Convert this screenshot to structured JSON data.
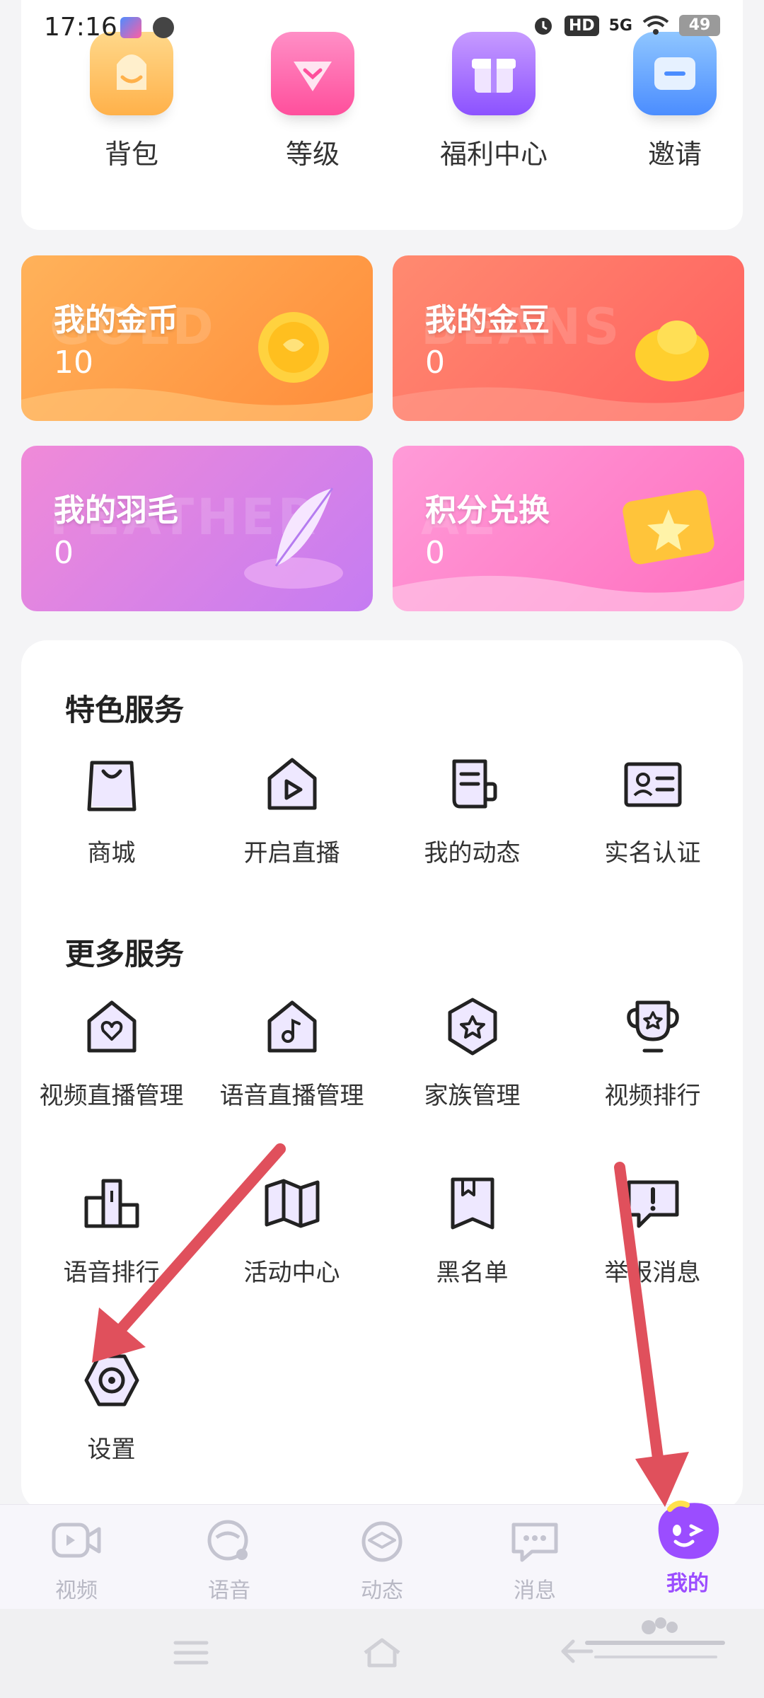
{
  "status": {
    "time": "17:16",
    "hd": "HD",
    "net": "5G",
    "battery": "49"
  },
  "quick_actions": [
    {
      "label": "背包",
      "icon": "backpack-icon"
    },
    {
      "label": "等级",
      "icon": "level-icon"
    },
    {
      "label": "福利中心",
      "icon": "gift-icon"
    },
    {
      "label": "邀请",
      "icon": "invite-ticket-icon"
    }
  ],
  "assets": [
    {
      "title": "我的金币",
      "value": "10",
      "watermark": "GOLD"
    },
    {
      "title": "我的金豆",
      "value": "0",
      "watermark": "BEANS"
    },
    {
      "title": "我的羽毛",
      "value": "0",
      "watermark": "FEATHER"
    },
    {
      "title": "积分兑换",
      "value": "0",
      "watermark": "AL"
    }
  ],
  "featured": {
    "title": "特色服务",
    "items": [
      {
        "label": "商城",
        "icon": "shopping-bag-icon"
      },
      {
        "label": "开启直播",
        "icon": "live-play-icon"
      },
      {
        "label": "我的动态",
        "icon": "moments-icon"
      },
      {
        "label": "实名认证",
        "icon": "id-card-icon"
      }
    ]
  },
  "more": {
    "title": "更多服务",
    "items": [
      {
        "label": "视频直播管理",
        "icon": "video-live-manage-icon"
      },
      {
        "label": "语音直播管理",
        "icon": "voice-live-manage-icon"
      },
      {
        "label": "家族管理",
        "icon": "family-icon"
      },
      {
        "label": "视频排行",
        "icon": "trophy-icon"
      },
      {
        "label": "语音排行",
        "icon": "podium-icon"
      },
      {
        "label": "活动中心",
        "icon": "map-icon"
      },
      {
        "label": "黑名单",
        "icon": "bookmark-icon"
      },
      {
        "label": "举报消息",
        "icon": "report-icon"
      },
      {
        "label": "设置",
        "icon": "settings-icon"
      }
    ]
  },
  "nav": [
    {
      "label": "视频",
      "icon": "video-tab-icon"
    },
    {
      "label": "语音",
      "icon": "voice-tab-icon"
    },
    {
      "label": "动态",
      "icon": "moments-tab-icon"
    },
    {
      "label": "消息",
      "icon": "message-tab-icon"
    },
    {
      "label": "我的",
      "icon": "me-tab-icon"
    }
  ],
  "colors": {
    "accent": "#9b4dff",
    "arrow": "#e0505c"
  }
}
